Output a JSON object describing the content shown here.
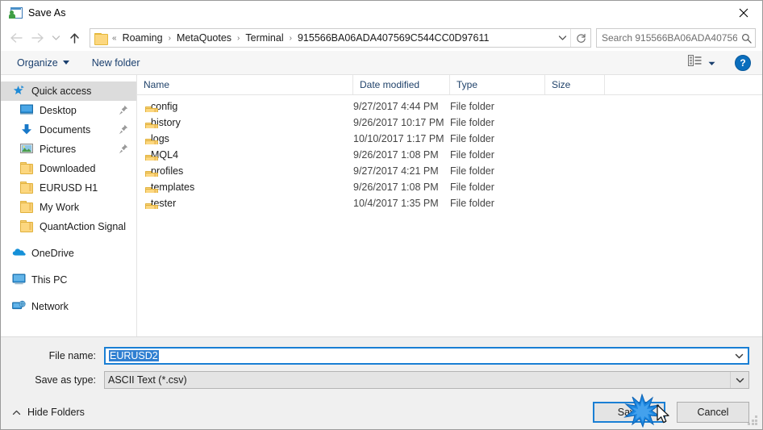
{
  "window": {
    "title": "Save As",
    "title_icon": "save-as-window-icon",
    "close_label": "✕"
  },
  "nav": {
    "back_icon": "back-arrow-icon",
    "forward_icon": "forward-arrow-icon",
    "recent_icon": "recent-locations-chevron-icon",
    "up_icon": "up-arrow-icon",
    "breadcrumb_prefix": "«",
    "breadcrumb": [
      "Roaming",
      "MetaQuotes",
      "Terminal",
      "915566BA06ADA407569C544CC0D97611"
    ],
    "separator": "›",
    "dropdown_icon": "chevron-down-icon",
    "refresh_icon": "refresh-icon"
  },
  "search": {
    "placeholder": "Search 915566BA06ADA40756...",
    "icon": "search-icon"
  },
  "toolbar": {
    "organize_label": "Organize",
    "new_folder_label": "New folder",
    "view_icon": "view-layout-icon",
    "view_caret_icon": "chevron-down-icon",
    "help_label": "?",
    "help_icon": "help-icon"
  },
  "sidebar": {
    "items": [
      {
        "label": "Quick access",
        "icon": "quick-access-star-icon",
        "selected": true,
        "indent": false,
        "pinned": false
      },
      {
        "label": "Desktop",
        "icon": "desktop-icon",
        "selected": false,
        "indent": true,
        "pinned": true
      },
      {
        "label": "Documents",
        "icon": "documents-icon",
        "selected": false,
        "indent": true,
        "pinned": true
      },
      {
        "label": "Pictures",
        "icon": "pictures-icon",
        "selected": false,
        "indent": true,
        "pinned": true
      },
      {
        "label": "Downloaded",
        "icon": "folder-icon",
        "selected": false,
        "indent": true,
        "pinned": false
      },
      {
        "label": "EURUSD H1",
        "icon": "folder-icon",
        "selected": false,
        "indent": true,
        "pinned": false
      },
      {
        "label": "My Work",
        "icon": "folder-icon",
        "selected": false,
        "indent": true,
        "pinned": false
      },
      {
        "label": "QuantAction Signal",
        "icon": "folder-icon",
        "selected": false,
        "indent": true,
        "pinned": false
      },
      {
        "label": "OneDrive",
        "icon": "onedrive-icon",
        "selected": false,
        "indent": false,
        "pinned": false
      },
      {
        "label": "This PC",
        "icon": "this-pc-icon",
        "selected": false,
        "indent": false,
        "pinned": false
      },
      {
        "label": "Network",
        "icon": "network-icon",
        "selected": false,
        "indent": false,
        "pinned": false
      }
    ]
  },
  "filelist": {
    "columns": [
      "Name",
      "Date modified",
      "Type",
      "Size"
    ],
    "sort_column": "Name",
    "sort_direction": "ascending",
    "rows": [
      {
        "name": "config",
        "date": "9/27/2017 4:44 PM",
        "type": "File folder",
        "size": ""
      },
      {
        "name": "history",
        "date": "9/26/2017 10:17 PM",
        "type": "File folder",
        "size": ""
      },
      {
        "name": "logs",
        "date": "10/10/2017 1:17 PM",
        "type": "File folder",
        "size": ""
      },
      {
        "name": "MQL4",
        "date": "9/26/2017 1:08 PM",
        "type": "File folder",
        "size": ""
      },
      {
        "name": "profiles",
        "date": "9/27/2017 4:21 PM",
        "type": "File folder",
        "size": ""
      },
      {
        "name": "templates",
        "date": "9/26/2017 1:08 PM",
        "type": "File folder",
        "size": ""
      },
      {
        "name": "tester",
        "date": "10/4/2017 1:35 PM",
        "type": "File folder",
        "size": ""
      }
    ]
  },
  "form": {
    "filename_label": "File name:",
    "filename_value": "EURUSD2",
    "filetype_label": "Save as type:",
    "filetype_value": "ASCII Text (*.csv)"
  },
  "footer": {
    "hide_folders_label": "Hide Folders",
    "hide_folders_icon": "chevron-up-icon",
    "save_label": "Save",
    "cancel_label": "Cancel",
    "resize_grip_icon": "resize-grip-icon",
    "click_burst_icon": "click-burst-icon",
    "cursor_icon": "mouse-pointer-icon"
  },
  "colors": {
    "accent": "#1a7fd4",
    "folder": "#fcd77f",
    "header_text": "#21436b",
    "selection": "#2f7fd1",
    "chrome": "#f0f0f0"
  }
}
